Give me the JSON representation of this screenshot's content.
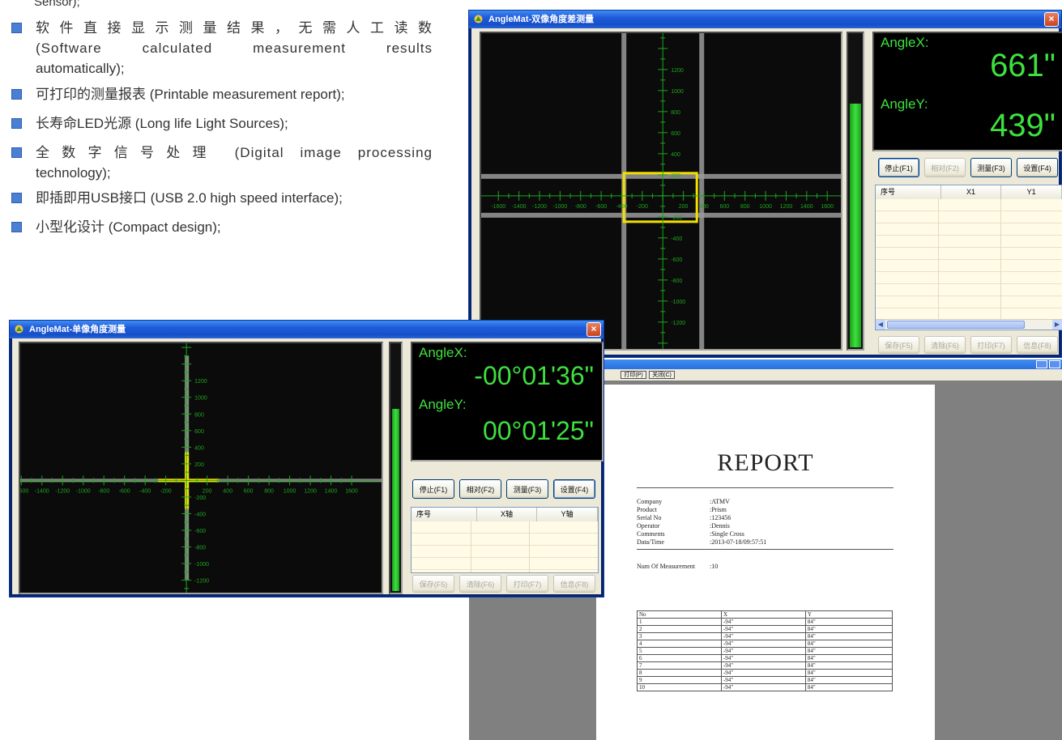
{
  "bullets": {
    "fragment": "Sensor);",
    "items": [
      {
        "cn": "软件直接显示测量结果，无需人工读数",
        "en1": "(Software calculated measurement results",
        "en2": "automatically);"
      },
      {
        "line": "可打印的测量报表 (Printable measurement report);"
      },
      {
        "line": "长寿命LED光源 (Long life Light Sources);"
      },
      {
        "cn": "全数字信号处理 (Digital image processing",
        "en2": "technology);"
      },
      {
        "line": "即插即用USB接口 (USB 2.0 high speed interface);"
      },
      {
        "line": "小型化设计 (Compact design);"
      }
    ],
    "bullet_color": "#4a7fd4"
  },
  "window_dual": {
    "title": "AngleMat-双像角度差测量",
    "close": "×",
    "angle_x_label": "AngleX:",
    "angle_x_value": "661\"",
    "angle_y_label": "AngleY:",
    "angle_y_value": "439\"",
    "buttons": [
      "停止(F1)",
      "相对(F2)",
      "测量(F3)",
      "设置(F4)"
    ],
    "bottom_buttons": [
      "保存(F5)",
      "清除(F6)",
      "打印(F7)",
      "信息(F8)"
    ],
    "table_headers": [
      "序号",
      "X1",
      "Y1"
    ],
    "meter_level": 0.78,
    "ruler_x_labels": [
      "-1600",
      "-1400",
      "-1200",
      "-1000",
      "-800",
      "-600",
      "-400",
      "-200",
      "200",
      "400",
      "600",
      "800",
      "1000",
      "1200",
      "1400",
      "1600"
    ],
    "ruler_y_labels": [
      "1200",
      "1000",
      "800",
      "600",
      "400",
      "200",
      "-200",
      "-400",
      "-600",
      "-800",
      "-1000",
      "-1200"
    ]
  },
  "window_single": {
    "title": "AngleMat-单像角度测量",
    "close": "×",
    "angle_x_label": "AngleX:",
    "angle_x_value": "-00°01'36\"",
    "angle_y_label": "AngleY:",
    "angle_y_value": "00°01'25\"",
    "buttons": [
      "停止(F1)",
      "相对(F2)",
      "测量(F3)",
      "设置(F4)"
    ],
    "bottom_buttons": [
      "保存(F5)",
      "清除(F6)",
      "打印(F7)",
      "信息(F8)"
    ],
    "table_headers": [
      "序号",
      "X轴",
      "Y轴"
    ],
    "meter_level": 0.74,
    "ruler_x_labels": [
      "-1600",
      "-1400",
      "-1200",
      "-1000",
      "-800",
      "-600",
      "-400",
      "-200",
      "200",
      "400",
      "600",
      "800",
      "1000",
      "1200",
      "1400",
      "1600"
    ],
    "ruler_y_labels": [
      "1200",
      "1000",
      "800",
      "600",
      "400",
      "200",
      "-200",
      "-400",
      "-600",
      "-800",
      "-1000",
      "-1200"
    ]
  },
  "report": {
    "toolbar_buttons": [
      "打印(P)",
      "关闭(C)"
    ],
    "title": "REPORT",
    "fields": [
      {
        "k": "Company",
        "v": ":ATMV"
      },
      {
        "k": "Product",
        "v": ":Prism"
      },
      {
        "k": "Serial No",
        "v": ":123456"
      },
      {
        "k": "Operator",
        "v": ":Dennis"
      },
      {
        "k": "Comments",
        "v": ":Single Cross"
      },
      {
        "k": "Data/Time",
        "v": ":2013-07-18/09:57:51"
      }
    ],
    "num_label": "Num Of Measurement",
    "num_value": ":10",
    "table_headers": [
      "No",
      "X",
      "Y"
    ],
    "rows": [
      [
        "1",
        "-94\"",
        "84\""
      ],
      [
        "2",
        "-94\"",
        "84\""
      ],
      [
        "3",
        "-94\"",
        "84\""
      ],
      [
        "4",
        "-94\"",
        "84\""
      ],
      [
        "5",
        "-94\"",
        "84\""
      ],
      [
        "6",
        "-94\"",
        "84\""
      ],
      [
        "7",
        "-94\"",
        "84\""
      ],
      [
        "8",
        "-94\"",
        "84\""
      ],
      [
        "9",
        "-94\"",
        "84\""
      ],
      [
        "10",
        "-94\"",
        "84\""
      ]
    ]
  },
  "colors": {
    "readout_green": "#3ee03e",
    "crosshair_yellow": "#f4e000",
    "ruler_green": "#1fa51f",
    "titlebar_blue": "#1f5ad9"
  }
}
